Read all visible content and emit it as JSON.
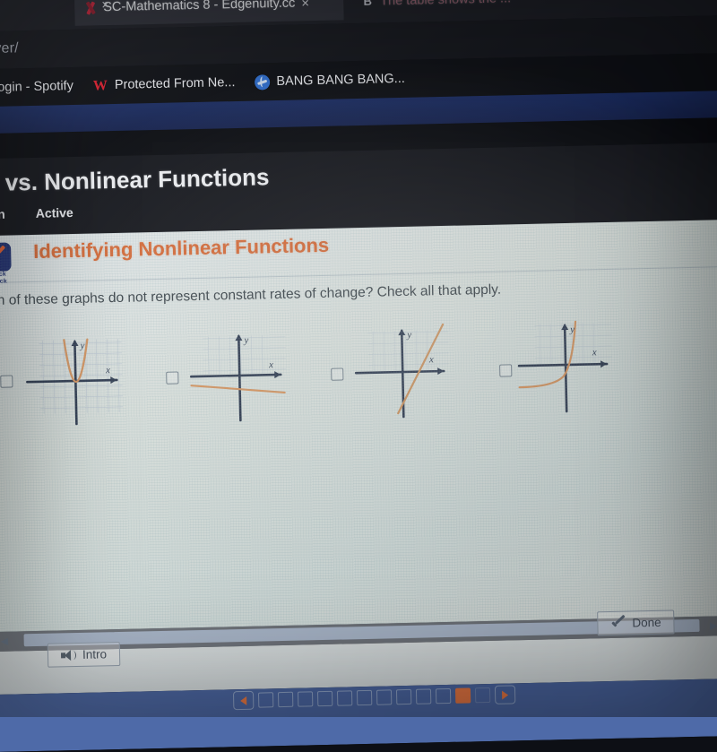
{
  "browser": {
    "tabs": [
      {
        "title": "SC-Mathematics 8 - Edgenuity.cc",
        "favicon": "edgenuity-favicon",
        "close_label": "×",
        "active": true
      },
      {
        "title": "The table shows the ...",
        "favicon": "b-favicon",
        "close_label": "×",
        "active": false
      }
    ],
    "first_tab_close": "×",
    "url": "ayer/",
    "bookmarks": [
      {
        "label": "Login - Spotify",
        "icon": "none"
      },
      {
        "label": "Protected From Ne...",
        "icon": "w-icon"
      },
      {
        "label": "BANG BANG BANG...",
        "icon": "globe-icon"
      }
    ]
  },
  "lesson": {
    "title": "ear vs. Nonlinear Functions",
    "tabs": [
      {
        "label": "ruction"
      },
      {
        "label": "Active"
      }
    ]
  },
  "quick_check": {
    "line1": "Quick",
    "line2": "Check"
  },
  "section": {
    "title": "Identifying Nonlinear Functions",
    "question": "Which of these graphs do not represent constant rates of change? Check all that apply."
  },
  "options": [
    {
      "id": "option-1",
      "graph": "parabola-upward",
      "checked": false,
      "x_label": "x",
      "y_label": "y"
    },
    {
      "id": "option-2",
      "graph": "shallow-negative-line",
      "checked": false,
      "x_label": "x",
      "y_label": "y"
    },
    {
      "id": "option-3",
      "graph": "steep-positive-line",
      "checked": false,
      "x_label": "x",
      "y_label": "y"
    },
    {
      "id": "option-4",
      "graph": "exponential-curve",
      "checked": false,
      "x_label": "x",
      "y_label": "y"
    }
  ],
  "toolbar": {
    "intro_label": "Intro",
    "done_label": "Done",
    "scroll_left": "◀",
    "scroll_right": "▶"
  },
  "pagination": {
    "total_boxes": 12,
    "current_index": 10,
    "dim_index": 11,
    "prev_label": "prev",
    "next_label": "next"
  },
  "colors": {
    "accent_orange": "#ef7b45",
    "section_orange": "#e06a33",
    "badge_navy": "#1f2f75",
    "pager_blue": "#4e6aa8",
    "graph_axis": "#2f3b52",
    "graph_curve": "#e09a62"
  }
}
